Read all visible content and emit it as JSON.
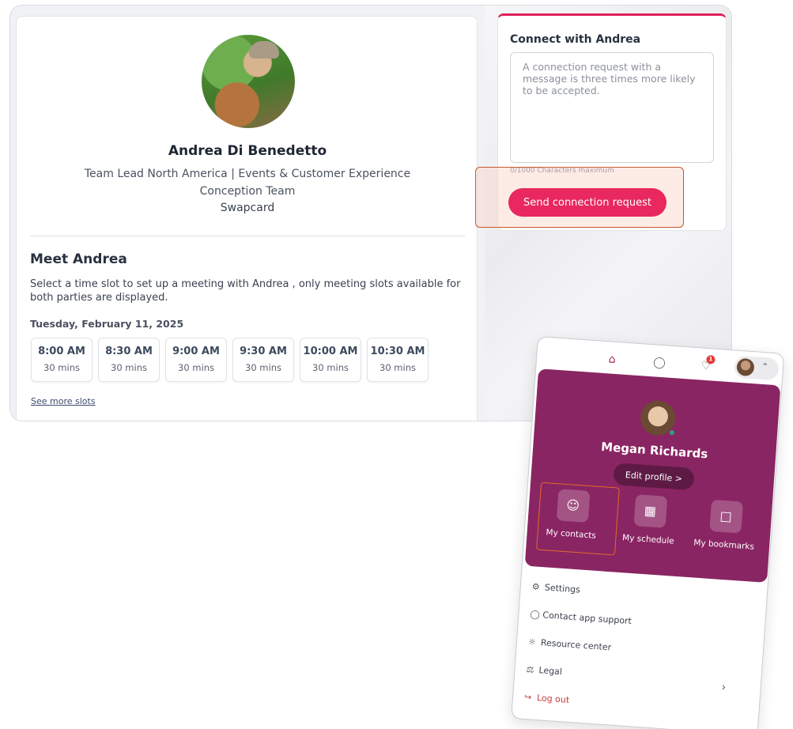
{
  "profile": {
    "name": "Andrea Di Benedetto",
    "role": "Team Lead North America | Events & Customer Experience Conception Team",
    "company": "Swapcard"
  },
  "meet": {
    "title": "Meet Andrea",
    "description": "Select a time slot to set up a meeting with Andrea , only meeting slots available for both parties are displayed.",
    "date": "Tuesday, February 11, 2025",
    "slots": [
      {
        "time": "8:00 AM",
        "duration": "30 mins"
      },
      {
        "time": "8:30 AM",
        "duration": "30 mins"
      },
      {
        "time": "9:00 AM",
        "duration": "30 mins"
      },
      {
        "time": "9:30 AM",
        "duration": "30 mins"
      },
      {
        "time": "10:00 AM",
        "duration": "30 mins"
      },
      {
        "time": "10:30 AM",
        "duration": "30 mins"
      }
    ],
    "see_more": "See more slots"
  },
  "connect": {
    "title": "Connect with Andrea",
    "placeholder": "A connection request with a message is three times more likely to be accepted.",
    "char_limit": "0/1000 Characters maximum",
    "send_label": "Send connection request"
  },
  "panel": {
    "notification_count": "1",
    "user_name": "Megan Richards",
    "edit_profile": "Edit profile  >",
    "quick_links": [
      {
        "label": "My contacts",
        "icon": "contacts-icon"
      },
      {
        "label": "My schedule",
        "icon": "calendar-icon"
      },
      {
        "label": "My bookmarks",
        "icon": "bookmark-icon"
      }
    ],
    "menu": [
      {
        "label": "Settings",
        "icon": "gear-icon"
      },
      {
        "label": "Contact app support",
        "icon": "chat-icon"
      },
      {
        "label": "Resource center",
        "icon": "lightbulb-icon"
      },
      {
        "label": "Legal",
        "icon": "gavel-icon"
      },
      {
        "label": "Log out",
        "icon": "logout-icon"
      }
    ]
  },
  "colors": {
    "accent": "#e8285f",
    "panel_purple": "#8a2563",
    "highlight": "#c9582e"
  }
}
